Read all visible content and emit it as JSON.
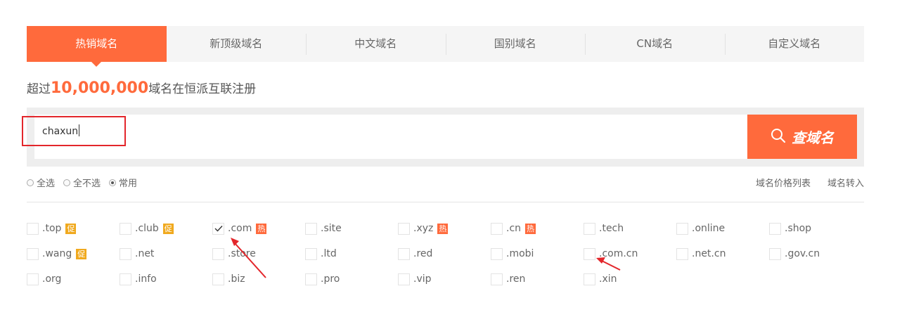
{
  "tabs": [
    "热销域名",
    "新顶级域名",
    "中文域名",
    "国别域名",
    "CN域名",
    "自定义域名"
  ],
  "headline": {
    "prefix": "超过",
    "number": "10,000,000",
    "suffix": "域名在恒派互联注册"
  },
  "search": {
    "value": "chaxun",
    "button_label": "查域名",
    "button_icon": "search-icon"
  },
  "radios": [
    {
      "label": "全选",
      "checked": false
    },
    {
      "label": "全不选",
      "checked": false
    },
    {
      "label": "常用",
      "checked": true
    }
  ],
  "links": [
    "域名价格列表",
    "域名转入"
  ],
  "domains": [
    {
      "name": ".top",
      "badge": "促",
      "badge_type": "promo",
      "checked": false
    },
    {
      "name": ".club",
      "badge": "促",
      "badge_type": "promo",
      "checked": false
    },
    {
      "name": ".com",
      "badge": "热",
      "badge_type": "hot",
      "checked": true
    },
    {
      "name": ".site",
      "badge": "",
      "checked": false
    },
    {
      "name": ".xyz",
      "badge": "热",
      "badge_type": "hot",
      "checked": false
    },
    {
      "name": ".cn",
      "badge": "热",
      "badge_type": "hot",
      "checked": false
    },
    {
      "name": ".tech",
      "badge": "",
      "checked": false
    },
    {
      "name": ".online",
      "badge": "",
      "checked": false
    },
    {
      "name": ".shop",
      "badge": "",
      "checked": false
    },
    {
      "name": ".wang",
      "badge": "促",
      "badge_type": "promo",
      "checked": false
    },
    {
      "name": ".net",
      "badge": "",
      "checked": false
    },
    {
      "name": ".store",
      "badge": "",
      "checked": false
    },
    {
      "name": ".ltd",
      "badge": "",
      "checked": false
    },
    {
      "name": ".red",
      "badge": "",
      "checked": false
    },
    {
      "name": ".mobi",
      "badge": "",
      "checked": false
    },
    {
      "name": ".com.cn",
      "badge": "",
      "checked": false
    },
    {
      "name": ".net.cn",
      "badge": "",
      "checked": false
    },
    {
      "name": ".gov.cn",
      "badge": "",
      "checked": false
    },
    {
      "name": ".org",
      "badge": "",
      "checked": false
    },
    {
      "name": ".info",
      "badge": "",
      "checked": false
    },
    {
      "name": ".biz",
      "badge": "",
      "checked": false
    },
    {
      "name": ".pro",
      "badge": "",
      "checked": false
    },
    {
      "name": ".vip",
      "badge": "",
      "checked": false
    },
    {
      "name": ".ren",
      "badge": "",
      "checked": false
    },
    {
      "name": ".xin",
      "badge": "",
      "checked": false
    }
  ],
  "colors": {
    "accent": "#ff6a3c",
    "promo": "#f0a91e",
    "annotation": "#e3262b"
  }
}
